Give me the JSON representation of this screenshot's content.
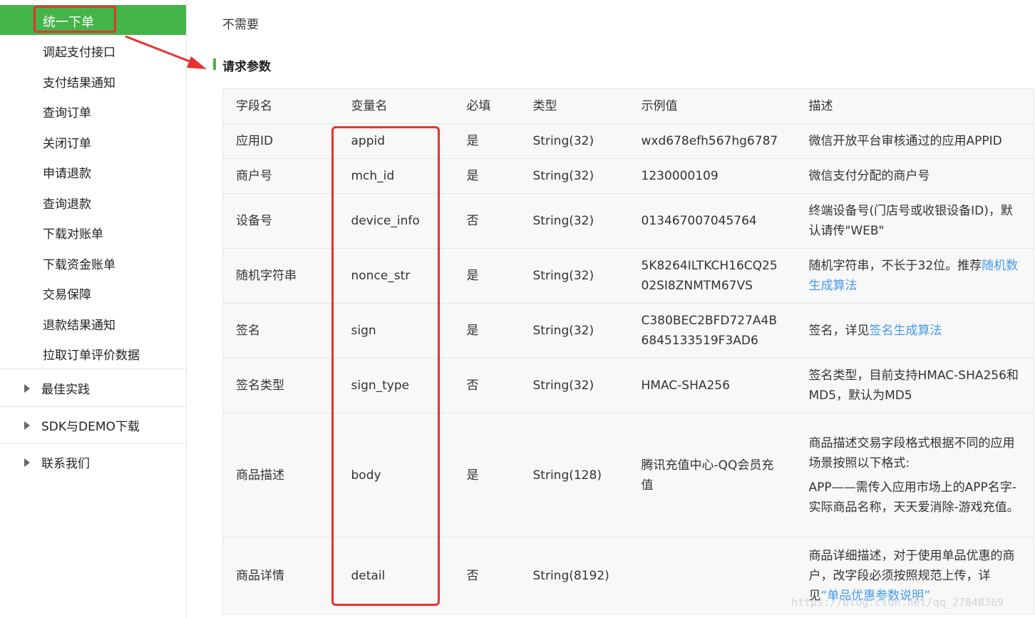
{
  "sidebar": {
    "active_item": "统一下单",
    "sub_items": [
      "调起支付接口",
      "支付结果通知",
      "查询订单",
      "关闭订单",
      "申请退款",
      "查询退款",
      "下载对账单",
      "下载资金账单",
      "交易保障",
      "退款结果通知",
      "拉取订单评价数据"
    ],
    "groups": [
      "最佳实践",
      "SDK与DEMO下载",
      "联系我们"
    ]
  },
  "content": {
    "prev_cell_text": "不需要",
    "section_title": "请求参数",
    "table": {
      "headers": [
        "字段名",
        "变量名",
        "必填",
        "类型",
        "示例值",
        "描述"
      ],
      "rows": [
        {
          "field": "应用ID",
          "var": "appid",
          "required": "是",
          "type": "String(32)",
          "example": "wxd678efh567hg6787",
          "desc": "微信开放平台审核通过的应用APPID"
        },
        {
          "field": "商户号",
          "var": "mch_id",
          "required": "是",
          "type": "String(32)",
          "example": "1230000109",
          "desc": "微信支付分配的商户号"
        },
        {
          "field": "设备号",
          "var": "device_info",
          "required": "否",
          "type": "String(32)",
          "example": "013467007045764",
          "desc": "终端设备号(门店号或收银设备ID)，默认请传\"WEB\""
        },
        {
          "field": "随机字符串",
          "var": "nonce_str",
          "required": "是",
          "type": "String(32)",
          "example": "5K8264ILTKCH16CQ2502SI8ZNMTM67VS",
          "desc": "随机字符串，不长于32位。推荐",
          "desc_link": "随机数生成算法"
        },
        {
          "field": "签名",
          "var": "sign",
          "required": "是",
          "type": "String(32)",
          "example": "C380BEC2BFD727A4B6845133519F3AD6",
          "desc": "签名，详见",
          "desc_link": "签名生成算法"
        },
        {
          "field": "签名类型",
          "var": "sign_type",
          "required": "否",
          "type": "String(32)",
          "example": "HMAC-SHA256",
          "desc": "签名类型，目前支持HMAC-SHA256和MD5，默认为MD5"
        },
        {
          "field": "商品描述",
          "var": "body",
          "required": "是",
          "type": "String(128)",
          "example": "腾讯充值中心-QQ会员充值",
          "desc": "商品描述交易字段格式根据不同的应用场景按照以下格式:",
          "desc2": "APP——需传入应用市场上的APP名字-实际商品名称，天天爱消除-游戏充值。"
        },
        {
          "field": "商品详情",
          "var": "detail",
          "required": "否",
          "type": "String(8192)",
          "example": "",
          "desc": "商品详细描述，对于使用单品优惠的商户，改字段必须按照规范上传，详见",
          "desc_link": "“单品优惠参数说明”"
        }
      ]
    }
  },
  "watermark": "https://blog.csdn.net/qq_27848369",
  "colors": {
    "accent_green": "#44b549",
    "annotation_red": "#e8312f",
    "link_blue": "#459ae9"
  }
}
